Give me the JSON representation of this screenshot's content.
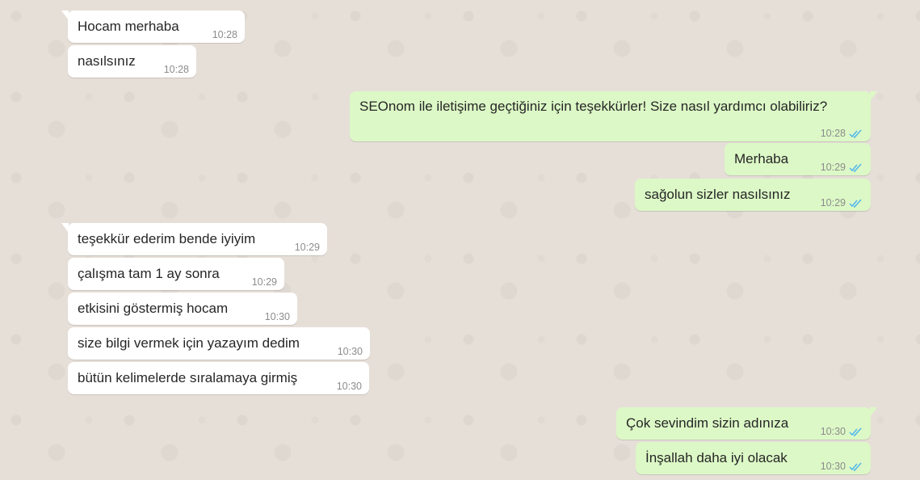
{
  "conversation": {
    "messages": [
      {
        "dir": "in",
        "text": "Hocam merhaba",
        "time": "10:28"
      },
      {
        "dir": "in",
        "text": "nasılsınız",
        "time": "10:28"
      },
      {
        "dir": "out",
        "text": "SEOnom ile iletişime geçtiğiniz için teşekkürler! Size nasıl yardımcı olabiliriz?",
        "time": "10:28",
        "status": "read"
      },
      {
        "dir": "out",
        "text": "Merhaba",
        "time": "10:29",
        "status": "read"
      },
      {
        "dir": "out",
        "text": "sağolun sizler nasılsınız",
        "time": "10:29",
        "status": "read"
      },
      {
        "dir": "in",
        "text": "teşekkür ederim bende iyiyim",
        "time": "10:29"
      },
      {
        "dir": "in",
        "text": "çalışma tam 1 ay sonra",
        "time": "10:29"
      },
      {
        "dir": "in",
        "text": "etkisini göstermiş hocam",
        "time": "10:30"
      },
      {
        "dir": "in",
        "text": "size bilgi vermek için yazayım dedim",
        "time": "10:30"
      },
      {
        "dir": "in",
        "text": "bütün kelimelerde sıralamaya girmiş",
        "time": "10:30"
      },
      {
        "dir": "out",
        "text": "Çok sevindim sizin adınıza",
        "time": "10:30",
        "status": "read"
      },
      {
        "dir": "out",
        "text": "İnşallah daha iyi olacak",
        "time": "10:30",
        "status": "read"
      }
    ]
  },
  "colors": {
    "incoming_bubble": "#ffffff",
    "outgoing_bubble": "#dcf8c6",
    "read_check": "#4fb6ec",
    "chat_background": "#e6dfd8"
  }
}
